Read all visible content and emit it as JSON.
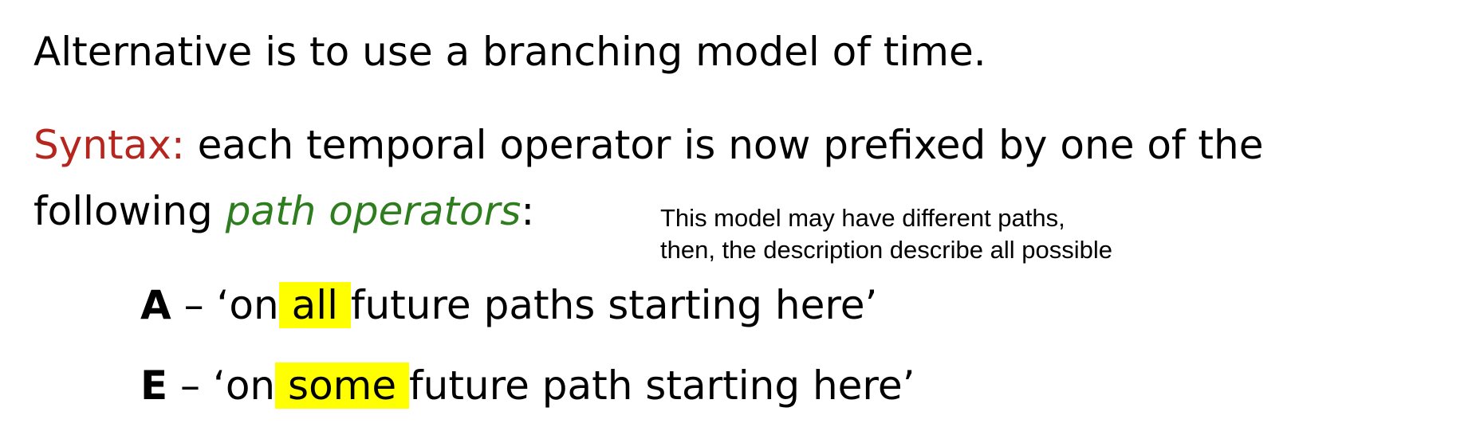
{
  "line1": "Alternative is to use a branching model of time.",
  "line2": {
    "label": "Syntax:",
    "text": " each temporal operator is now prefixed by one of the"
  },
  "line3": {
    "prefix": "following ",
    "term": "path operators",
    "suffix": ":"
  },
  "note": {
    "line1": "This model may have different paths,",
    "line2": "then, the description describe all possible"
  },
  "items": [
    {
      "symbol": "A",
      "dash": " – ‘on",
      "highlight": " all ",
      "rest": "future paths starting here’",
      "highlight_color": "#ffff00"
    },
    {
      "symbol": "E",
      "dash": " – ‘on",
      "highlight": " some ",
      "rest": "future path starting here’",
      "highlight_color": "#ffff00"
    }
  ],
  "colors": {
    "syntax_label": "#b5261e",
    "path_operators": "#2e7d1e"
  }
}
